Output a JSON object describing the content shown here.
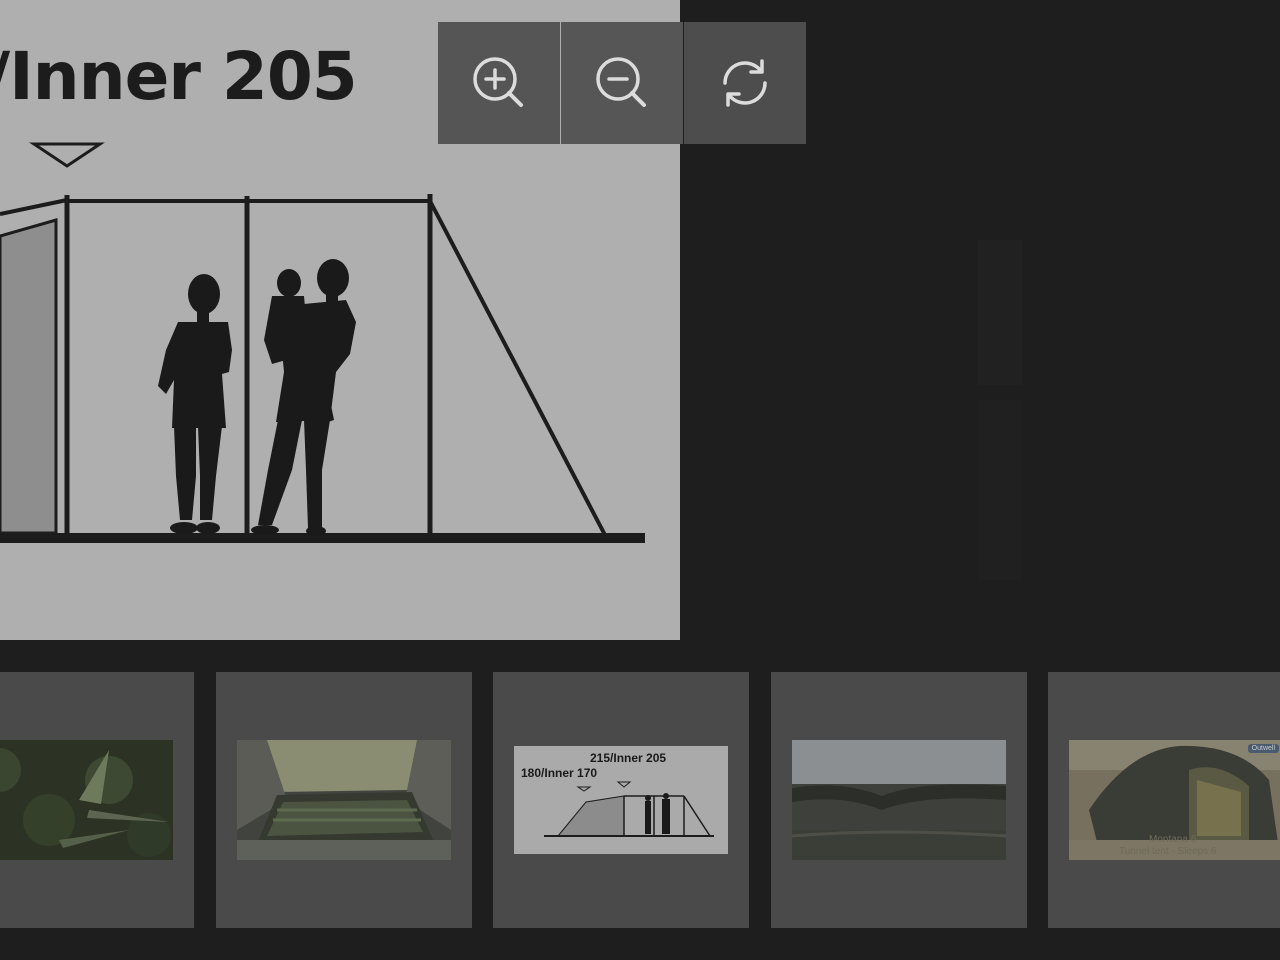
{
  "main_image": {
    "title": "/Inner 205"
  },
  "toolbar": {
    "zoom_in_icon": "zoom-in-icon",
    "zoom_out_icon": "zoom-out-icon",
    "reset_icon": "refresh-icon"
  },
  "thumbnails": [
    {
      "name": "thumb-1",
      "kind": "plants-photo"
    },
    {
      "name": "thumb-2",
      "kind": "tent-interior-photo"
    },
    {
      "name": "thumb-3",
      "kind": "tent-diagram",
      "label_right": "215/Inner 205",
      "label_left": "180/Inner 170"
    },
    {
      "name": "thumb-4",
      "kind": "tent-floor-photo"
    },
    {
      "name": "thumb-5",
      "kind": "tent-exterior-photo",
      "caption_line1": "Montana 6",
      "caption_line2": "Tunnel tent - Sleeps 6",
      "brand": "Outwell"
    }
  ],
  "colors": {
    "background": "#1e1e1e",
    "image_bg": "#afafaf",
    "toolbar": "#555555",
    "thumb_bg": "#4a4a4a"
  }
}
